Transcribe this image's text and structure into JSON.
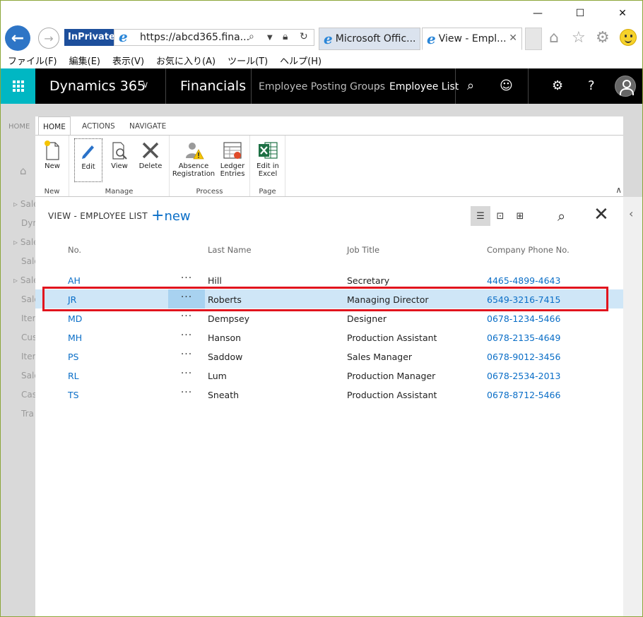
{
  "browser": {
    "inprivate_label": "InPrivate",
    "url": "https://abcd365.fina...",
    "tabs": [
      {
        "label": "Microsoft Offic..."
      },
      {
        "label": "View - Empl..."
      }
    ],
    "window_controls": {
      "minimize": "—",
      "maximize": "☐",
      "close": "✕"
    }
  },
  "menubar": {
    "items": [
      "ファイル(F)",
      "編集(E)",
      "表示(V)",
      "お気に入り(A)",
      "ツール(T)",
      "ヘルプ(H)"
    ]
  },
  "d365": {
    "app_name": "Dynamics 365",
    "module": "Financials",
    "breadcrumb_parent": "Employee Posting Groups",
    "breadcrumb_current": "Employee List"
  },
  "background": {
    "tab_label": "HOME",
    "items": [
      "Sale",
      "Dyn",
      "Sale",
      "Sale",
      "Sale",
      "Sale",
      "Iter",
      "Cus",
      "Iter",
      "Sale",
      "Cas",
      "Tra"
    ]
  },
  "ribbon": {
    "tabs": [
      "HOME",
      "ACTIONS",
      "NAVIGATE"
    ],
    "groups": [
      {
        "label": "New",
        "buttons": [
          "New"
        ]
      },
      {
        "label": "Manage",
        "buttons": [
          "Edit",
          "View",
          "Delete"
        ]
      },
      {
        "label": "Process",
        "buttons": [
          "Absence Registration",
          "Ledger Entries"
        ]
      },
      {
        "label": "Page",
        "buttons": [
          "Edit in Excel"
        ]
      }
    ]
  },
  "list": {
    "title": "VIEW - EMPLOYEE LIST",
    "new_label": "new",
    "columns": [
      "No.",
      "Last Name",
      "Job Title",
      "Company Phone No."
    ],
    "rows": [
      {
        "no": "AH",
        "last_name": "Hill",
        "job_title": "Secretary",
        "phone": "4465-4899-4643"
      },
      {
        "no": "JR",
        "last_name": "Roberts",
        "job_title": "Managing Director",
        "phone": "6549-3216-7415"
      },
      {
        "no": "MD",
        "last_name": "Dempsey",
        "job_title": "Designer",
        "phone": "0678-1234-5466"
      },
      {
        "no": "MH",
        "last_name": "Hanson",
        "job_title": "Production Assistant",
        "phone": "0678-2135-4649"
      },
      {
        "no": "PS",
        "last_name": "Saddow",
        "job_title": "Sales Manager",
        "phone": "0678-9012-3456"
      },
      {
        "no": "RL",
        "last_name": "Lum",
        "job_title": "Production Manager",
        "phone": "0678-2534-2013"
      },
      {
        "no": "TS",
        "last_name": "Sneath",
        "job_title": "Production Assistant",
        "phone": "0678-8712-5466"
      }
    ],
    "selected_row": 1,
    "row_menu_glyph": "···"
  },
  "colors": {
    "accent_link": "#0a6ec7",
    "waffle": "#00b7c3",
    "selected_row": "#cfe6f7",
    "highlight_box": "#e1141e"
  }
}
